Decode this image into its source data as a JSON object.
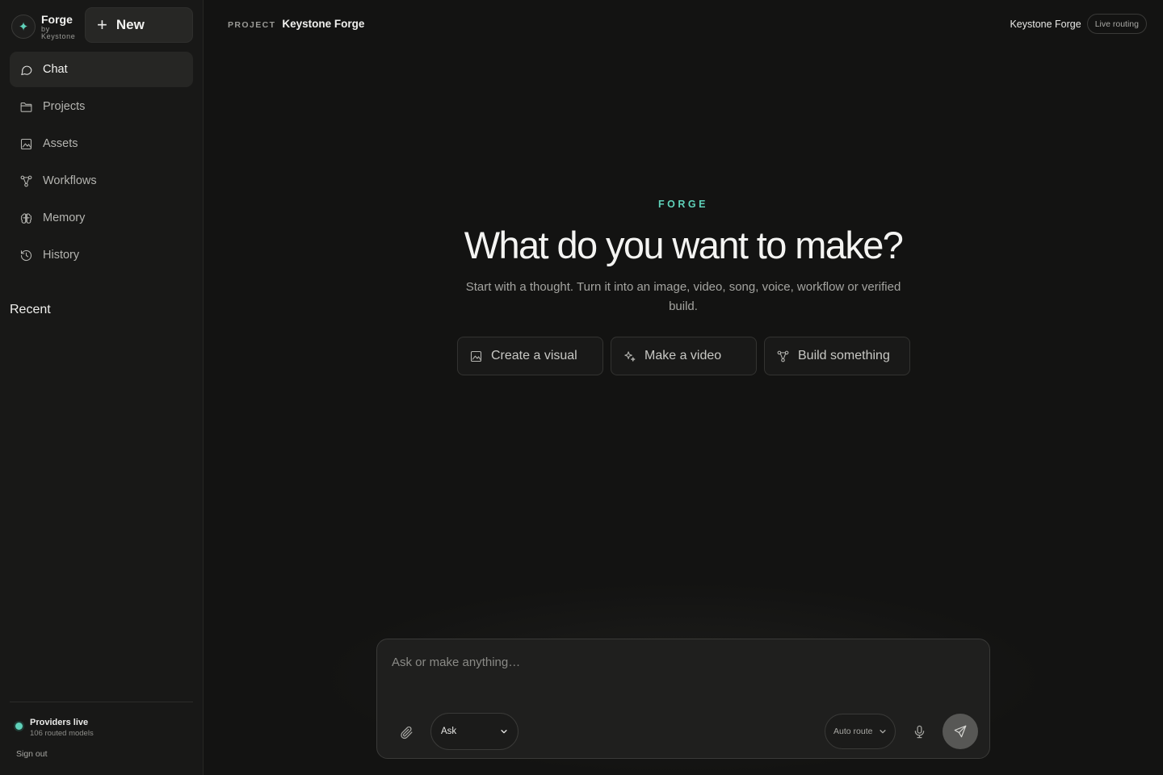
{
  "brand": {
    "name": "Forge",
    "byline": "by Keystone",
    "logo_icon": "sparkle-icon",
    "accent_color": "#5fd1b9"
  },
  "new_button": {
    "label": "New",
    "icon": "plus-icon"
  },
  "sidebar": {
    "items": [
      {
        "label": "Chat",
        "icon": "chat-bubble-icon",
        "active": true
      },
      {
        "label": "Projects",
        "icon": "folder-icon",
        "active": false
      },
      {
        "label": "Assets",
        "icon": "image-icon",
        "active": false
      },
      {
        "label": "Workflows",
        "icon": "workflow-icon",
        "active": false
      },
      {
        "label": "Memory",
        "icon": "brain-icon",
        "active": false
      },
      {
        "label": "History",
        "icon": "history-icon",
        "active": false
      }
    ],
    "recent_title": "Recent",
    "status": {
      "title": "Providers live",
      "subtitle": "106 routed models",
      "color": "#5fd1b9"
    },
    "sign_out": "Sign out"
  },
  "topbar": {
    "project_label": "PROJECT",
    "project_name": "Keystone Forge",
    "account_name": "Keystone Forge",
    "routing_badge": "Live routing"
  },
  "hero": {
    "eyebrow": "FORGE",
    "headline": "What do you want to make?",
    "subhead": "Start with a thought. Turn it into an image, video, song, voice, workflow or verified build."
  },
  "quick_actions": [
    {
      "label": "Create a visual",
      "icon": "image-icon"
    },
    {
      "label": "Make a video",
      "icon": "sparkles-icon"
    },
    {
      "label": "Build something",
      "icon": "workflow-icon"
    }
  ],
  "composer": {
    "placeholder": "Ask or make anything…",
    "value": "",
    "mode": "Ask",
    "route": "Auto route"
  }
}
